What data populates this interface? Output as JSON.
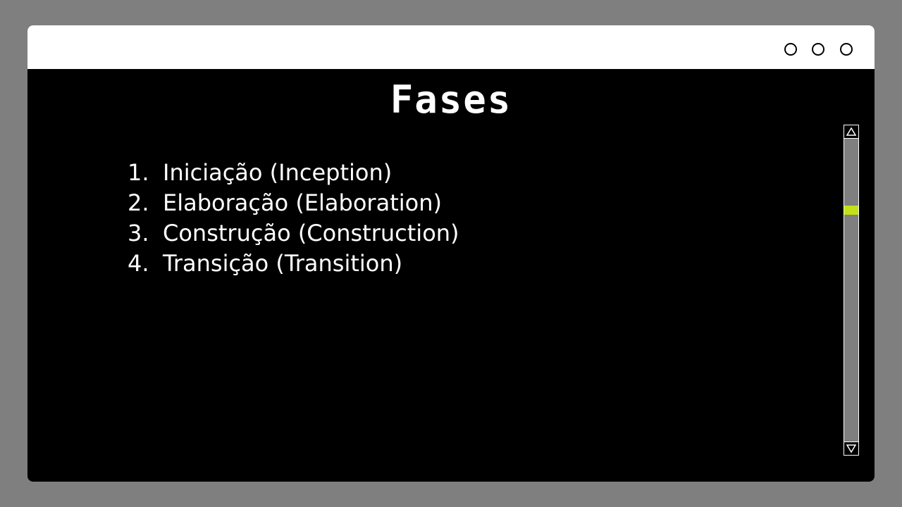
{
  "window": {
    "controls": [
      "window-button-1",
      "window-button-2",
      "window-button-3"
    ]
  },
  "slide": {
    "title": "Fases",
    "phases": [
      {
        "number": "1.",
        "label": "Iniciação (Inception)"
      },
      {
        "number": "2.",
        "label": "Elaboração (Elaboration)"
      },
      {
        "number": "3.",
        "label": "Construção (Construction)"
      },
      {
        "number": "4.",
        "label": "Transição (Transition)"
      }
    ]
  },
  "scrollbar": {
    "position_fraction": 0.23,
    "thumb_color": "#c4e017",
    "up_icon": "triangle-up-icon",
    "down_icon": "triangle-down-icon"
  },
  "colors": {
    "background": "#7f7f7f",
    "window": "#000000",
    "titlebar": "#ffffff",
    "accent": "#c4e017"
  }
}
